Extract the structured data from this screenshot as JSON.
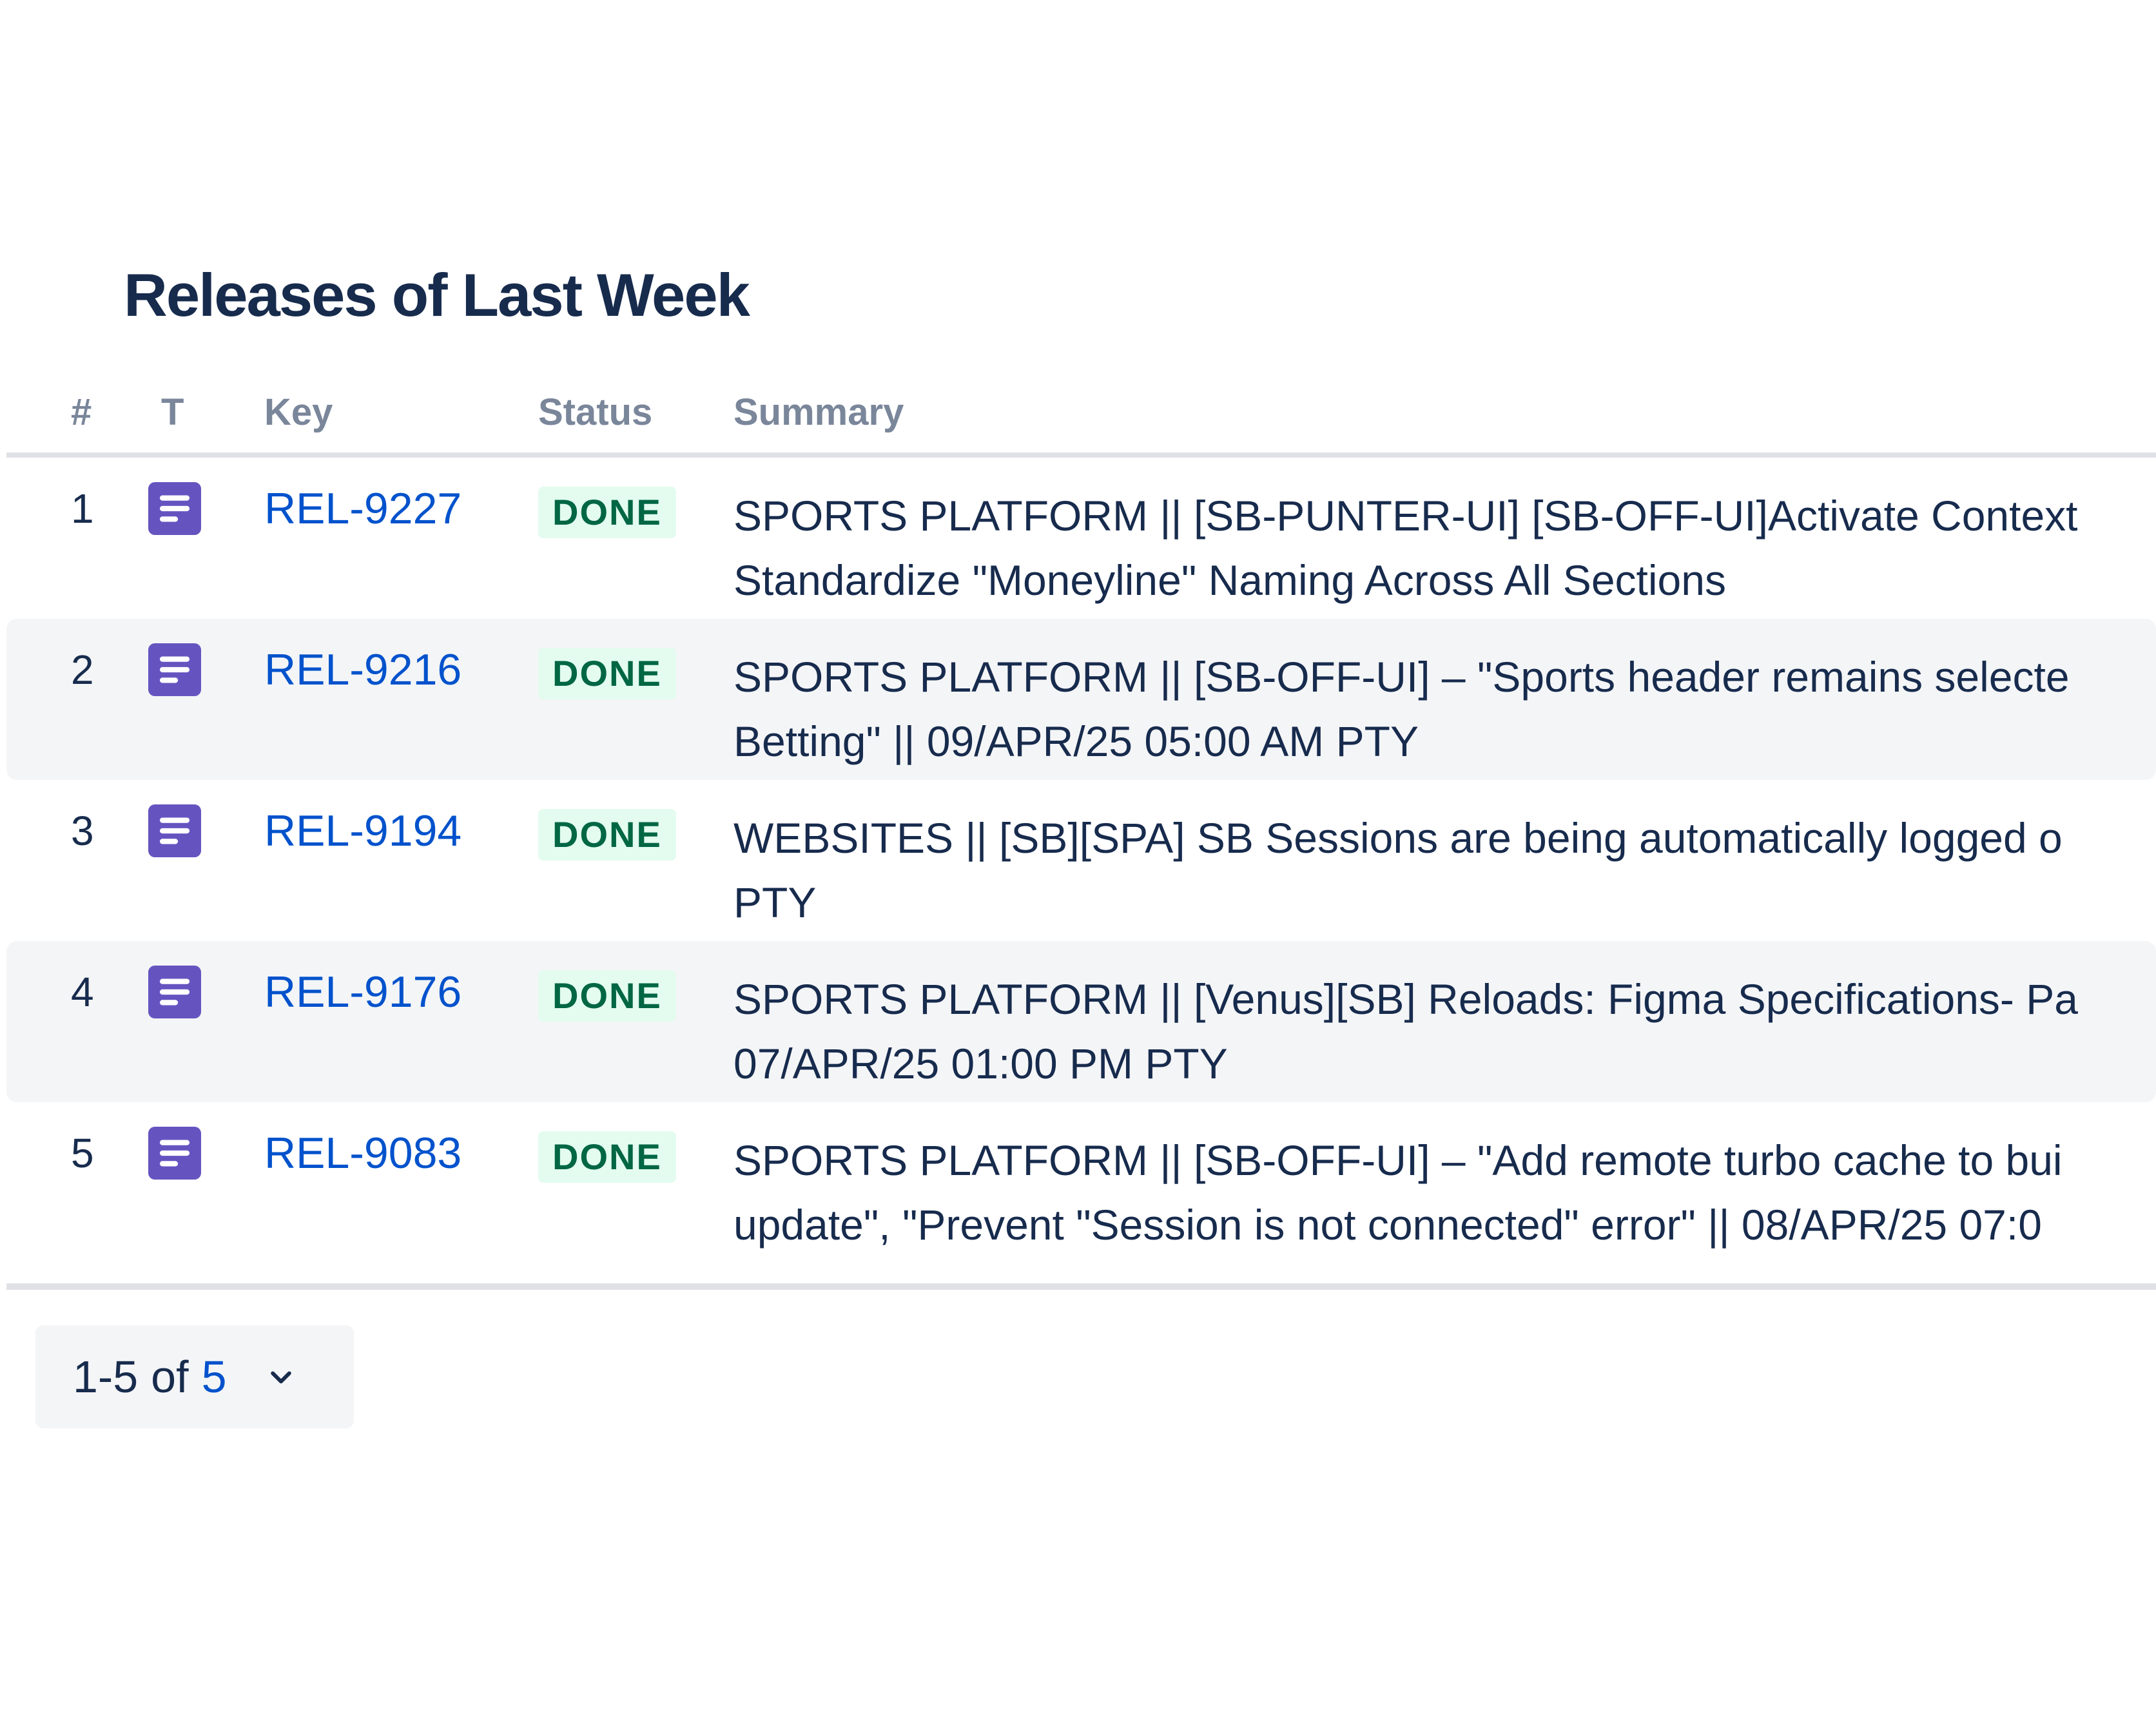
{
  "title": "Releases of Last Week",
  "columns": {
    "num": "#",
    "type": "T",
    "key": "Key",
    "status": "Status",
    "summary": "Summary"
  },
  "rows": [
    {
      "num": "1",
      "type_icon": "task-icon",
      "key": "REL-9227",
      "status": "DONE",
      "summary_line1": "SPORTS PLATFORM || [SB-PUNTER-UI] [SB-OFF-UI]Activate Context",
      "summary_line2": "Standardize \"Moneyline\" Naming Across All Sections"
    },
    {
      "num": "2",
      "type_icon": "task-icon",
      "key": "REL-9216",
      "status": "DONE",
      "summary_line1": "SPORTS PLATFORM || [SB-OFF-UI] – \"Sports header remains selecte",
      "summary_line2": "Betting\" || 09/APR/25 05:00 AM PTY"
    },
    {
      "num": "3",
      "type_icon": "task-icon",
      "key": "REL-9194",
      "status": "DONE",
      "summary_line1": "WEBSITES || [SB][SPA] SB Sessions are being automatically logged o",
      "summary_line2": "PTY"
    },
    {
      "num": "4",
      "type_icon": "task-icon",
      "key": "REL-9176",
      "status": "DONE",
      "summary_line1": "SPORTS PLATFORM || [Venus][SB] Reloads: Figma Specifications- Pa",
      "summary_line2": "07/APR/25 01:00 PM PTY"
    },
    {
      "num": "5",
      "type_icon": "task-icon",
      "key": "REL-9083",
      "status": "DONE",
      "summary_line1": "SPORTS PLATFORM || [SB-OFF-UI] – \"Add remote turbo cache to bui",
      "summary_line2": "update\", \"Prevent \"Session is not connected\" error\" || 08/APR/25 07:0"
    }
  ],
  "pagination": {
    "range": "1-5",
    "of": "of",
    "total": "5",
    "icon": "chevron-down-icon"
  },
  "colors": {
    "link": "#0052cc",
    "done_bg": "#e3fcef",
    "done_text": "#006644",
    "task_icon": "#6554c0",
    "stripe": "#f4f5f7"
  }
}
